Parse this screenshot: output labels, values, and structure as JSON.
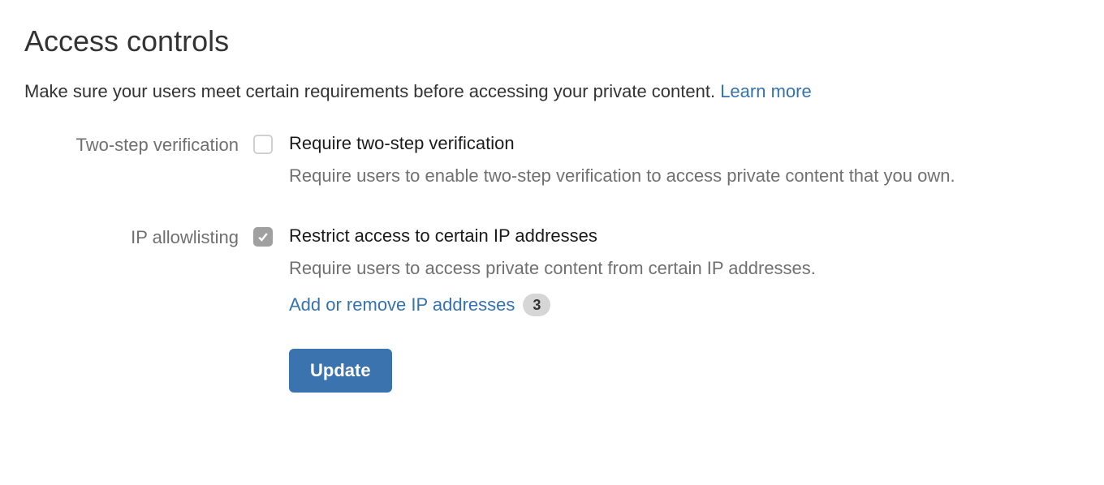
{
  "title": "Access controls",
  "intro_text": "Make sure your users meet certain requirements before accessing your private content. ",
  "intro_link": "Learn more",
  "two_step": {
    "row_label": "Two-step verification",
    "checked": false,
    "option_title": "Require two-step verification",
    "option_desc": "Require users to enable two-step verification to access private content that you own."
  },
  "ip_allow": {
    "row_label": "IP allowlisting",
    "checked": true,
    "option_title": "Restrict access to certain IP addresses",
    "option_desc": "Require users to access private content from certain IP addresses.",
    "manage_link": "Add or remove IP addresses",
    "badge_count": "3"
  },
  "update_button": "Update"
}
